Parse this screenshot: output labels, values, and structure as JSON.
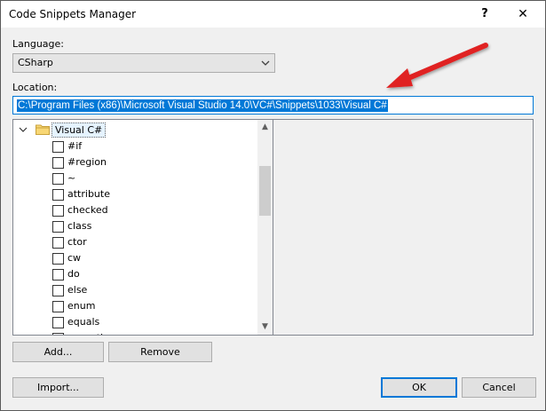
{
  "window": {
    "title": "Code Snippets Manager",
    "help_glyph": "?",
    "close_glyph": "✕"
  },
  "language": {
    "label": "Language:",
    "selected": "CSharp"
  },
  "location": {
    "label": "Location:",
    "value": "C:\\Program Files (x86)\\Microsoft Visual Studio 14.0\\VC#\\Snippets\\1033\\Visual C#"
  },
  "tree": {
    "root_label": "Visual C#",
    "items": [
      "#if",
      "#region",
      "~",
      "attribute",
      "checked",
      "class",
      "ctor",
      "cw",
      "do",
      "else",
      "enum",
      "equals",
      "exception"
    ]
  },
  "buttons": {
    "add": "Add...",
    "remove": "Remove",
    "import": "Import...",
    "ok": "OK",
    "cancel": "Cancel"
  },
  "colors": {
    "selection": "#0078d7",
    "arrow": "#e02020"
  },
  "icons": {
    "folder": "folder-icon",
    "expander": "chevron-down-icon",
    "dropdown": "chevron-down-icon"
  }
}
